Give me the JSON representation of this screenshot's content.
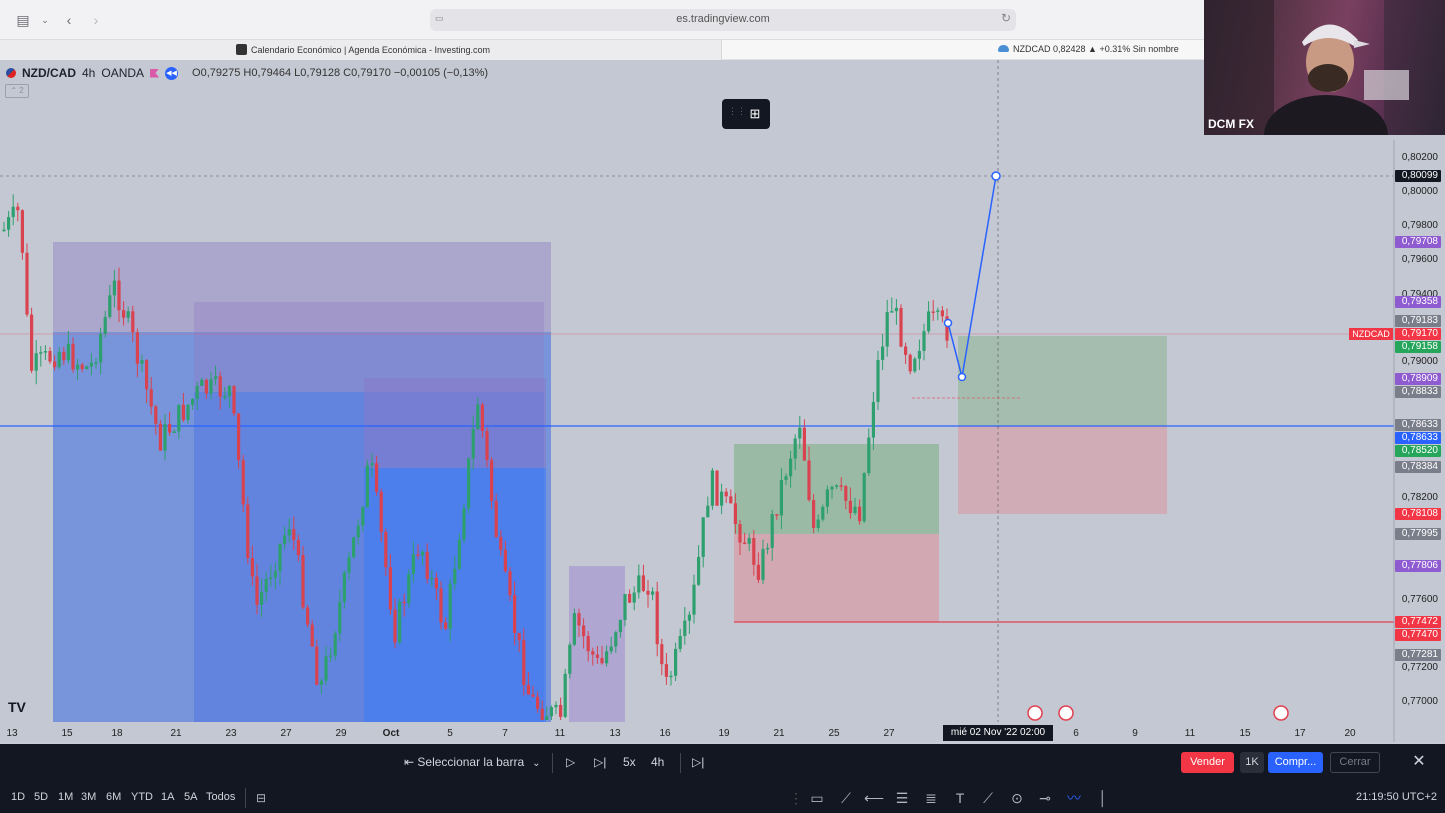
{
  "browser": {
    "url": "es.tradingview.com",
    "tabs": [
      {
        "label": "Calendario Económico | Agenda Económica - Investing.com"
      },
      {
        "label": "NZDCAD 0,82428 ▲ +0.31% Sin nombre"
      }
    ]
  },
  "legend": {
    "symbol": "NZD/CAD",
    "interval": "4h",
    "broker": "OANDA",
    "ohlc": "O0,79275  H0,79464  L0,79128  C0,79170  −0,00105 (−0,13%)",
    "sub": "⌃ 2"
  },
  "price_scale": {
    "labels": [
      {
        "text": "0,80200",
        "kind": "tick",
        "bg": ""
      },
      {
        "text": "0,80099",
        "kind": "badge",
        "bg": "#131722"
      },
      {
        "text": "0,80000",
        "kind": "tick",
        "bg": ""
      },
      {
        "text": "0,79800",
        "kind": "tick",
        "bg": ""
      },
      {
        "text": "0,79708",
        "kind": "badge",
        "bg": "#8e5bd1"
      },
      {
        "text": "0,79600",
        "kind": "tick",
        "bg": ""
      },
      {
        "text": "0,79400",
        "kind": "tick",
        "bg": ""
      },
      {
        "text": "0,79358",
        "kind": "badge",
        "bg": "#8e5bd1"
      },
      {
        "text": "0,79183",
        "kind": "badge",
        "bg": "#7a7e8a"
      },
      {
        "text": "0,79170",
        "kind": "badge",
        "bg": "#f23645"
      },
      {
        "text": "0,79158",
        "kind": "badge",
        "bg": "#26a65b"
      },
      {
        "text": "0,79000",
        "kind": "tick",
        "bg": ""
      },
      {
        "text": "0,78909",
        "kind": "badge",
        "bg": "#8e5bd1"
      },
      {
        "text": "0,78833",
        "kind": "badge",
        "bg": "#7a7e8a"
      },
      {
        "text": "0,78633",
        "kind": "badge",
        "bg": "#7a7e8a"
      },
      {
        "text": "0,78633",
        "kind": "badge",
        "bg": "#2962ff"
      },
      {
        "text": "0,78520",
        "kind": "badge",
        "bg": "#26a65b"
      },
      {
        "text": "0,78384",
        "kind": "badge",
        "bg": "#7a7e8a"
      },
      {
        "text": "0,78200",
        "kind": "tick",
        "bg": ""
      },
      {
        "text": "0,78108",
        "kind": "badge",
        "bg": "#f23645"
      },
      {
        "text": "0,77995",
        "kind": "badge",
        "bg": "#7a7e8a"
      },
      {
        "text": "0,77806",
        "kind": "badge",
        "bg": "#8e5bd1"
      },
      {
        "text": "0,77600",
        "kind": "tick",
        "bg": ""
      },
      {
        "text": "0,77472",
        "kind": "badge",
        "bg": "#f23645"
      },
      {
        "text": "0,77470",
        "kind": "badge",
        "bg": "#f23645"
      },
      {
        "text": "0,77281",
        "kind": "badge",
        "bg": "#7a7e8a"
      },
      {
        "text": "0,77200",
        "kind": "tick",
        "bg": ""
      },
      {
        "text": "0,77000",
        "kind": "tick",
        "bg": ""
      }
    ],
    "symbol_tag": "NZDCAD"
  },
  "time_axis": {
    "labels": [
      "13",
      "15",
      "18",
      "21",
      "23",
      "27",
      "29",
      "Oct",
      "5",
      "7",
      "11",
      "13",
      "16",
      "19",
      "21",
      "25",
      "27",
      "6",
      "9",
      "11",
      "15",
      "17",
      "20"
    ],
    "cursor": "mié 02 Nov '22   02:00"
  },
  "replay": {
    "select_bar": "Seleccionar la barra",
    "speed": "5x",
    "interval": "4h",
    "sell": "Vender",
    "qty": "1K",
    "buy": "Compr...",
    "close": "Cerrar"
  },
  "timeframes": [
    "1D",
    "5D",
    "1M",
    "3M",
    "6M",
    "YTD",
    "1A",
    "5A",
    "Todos"
  ],
  "clock": "21:19:50 UTC+2",
  "webcam": {
    "label": "DCM FX"
  },
  "colors": {
    "up": "#26a69a",
    "down": "#ef5350",
    "blue_zone": "#2962ff",
    "purple_zone": "#9c7bd6",
    "green_zone": "#4caf50",
    "red_zone": "#e57373"
  }
}
